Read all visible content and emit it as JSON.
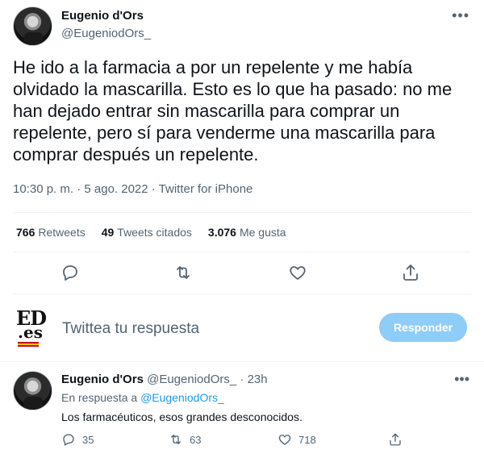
{
  "tweet": {
    "author_name": "Eugenio d'Ors",
    "author_handle": "@EugeniodOrs_",
    "more_icon": "ellipsis-icon",
    "text": "He ido a la farmacia a por un repelente y me había olvidado la mascarilla. Esto es lo que ha pasado: no me han dejado entrar sin mascarilla para comprar un repelente, pero sí para venderme una mascarilla para comprar después un repelente.",
    "meta": "10:30 p. m. · 5 ago. 2022 · Twitter for iPhone",
    "stats": {
      "retweets_count": "766",
      "retweets_label": "Retweets",
      "quotes_count": "49",
      "quotes_label": "Tweets citados",
      "likes_count": "3.076",
      "likes_label": "Me gusta"
    },
    "actions": [
      "reply-icon",
      "retweet-icon",
      "like-icon",
      "share-icon"
    ]
  },
  "composer": {
    "logo_top": "ED",
    "logo_bottom": ".es",
    "placeholder": "Twittea tu respuesta",
    "reply_button": "Responder",
    "button_color": "#8ecdf8"
  },
  "reply": {
    "author_name": "Eugenio d'Ors",
    "author_handle": "@EugeniodOrs_",
    "separator": "·",
    "time": "23h",
    "in_reply_prefix": "En respuesta a",
    "in_reply_mention": "@EugeniodOrs_",
    "text": "Los farmacéuticos, esos grandes desconocidos.",
    "reply_count": "35",
    "retweet_count": "63",
    "like_count": "718"
  },
  "colors": {
    "accent": "#1d9bf0",
    "secondary_text": "#536471",
    "divider": "#eff3f4"
  }
}
